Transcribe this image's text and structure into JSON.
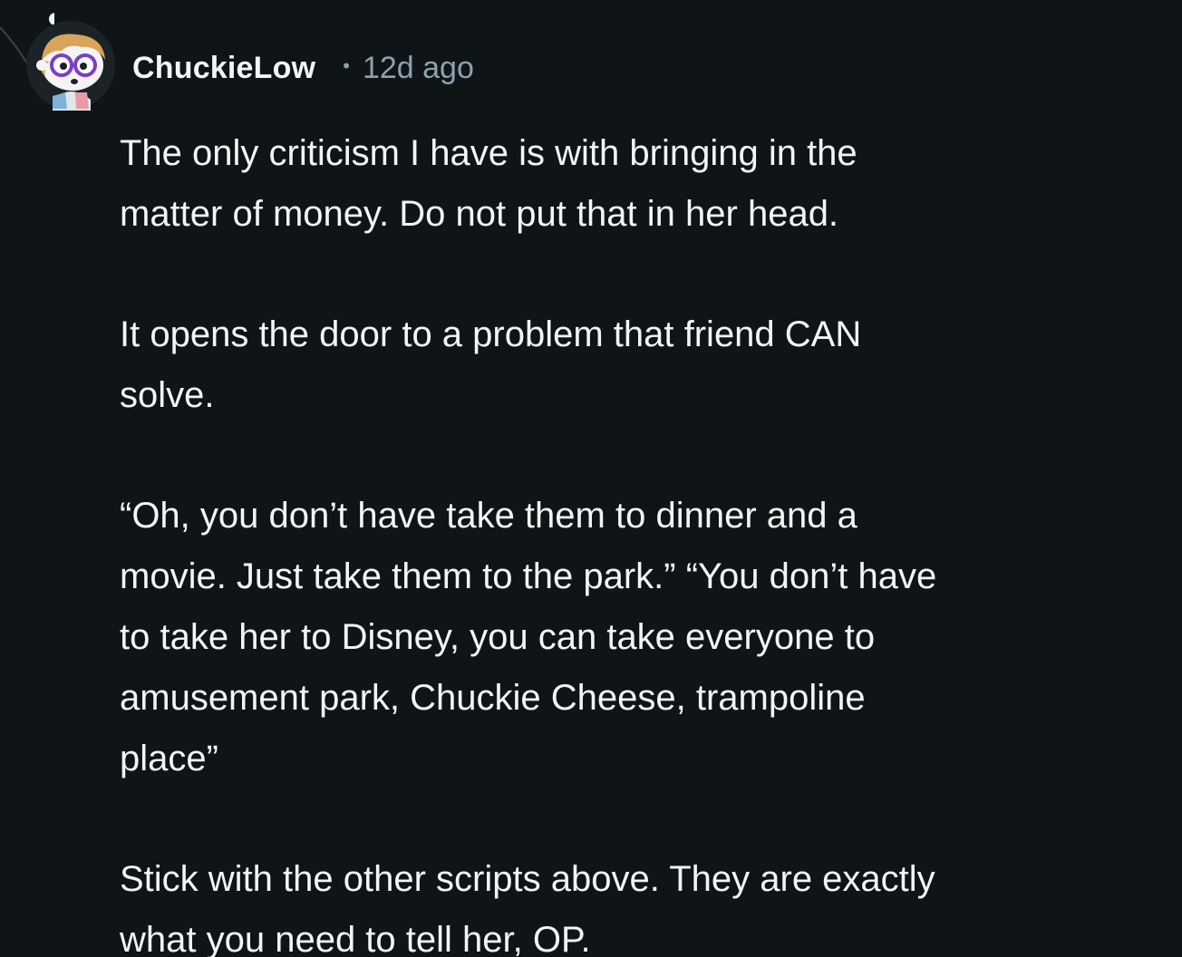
{
  "comment": {
    "author": "ChuckieLow",
    "separator": "•",
    "age": "12d ago",
    "avatar_icon": "snoo-avatar-icon",
    "paragraphs": [
      "The only criticism I have is with bringing in the\nmatter of money. Do not put that in her head.",
      "It opens the door to a problem that friend CAN\nsolve.",
      "“Oh, you don’t have take them to dinner and a\nmovie. Just take them to the park.” “You don’t have\nto take her to Disney, you can take everyone to\namusement park, Chuckie Cheese, trampoline\nplace”",
      "Stick with the other scripts above. They are exactly\nwhat you need to tell her, OP."
    ]
  },
  "colors": {
    "background": "#0f1416",
    "text": "#f2f4f5",
    "meta": "#8ba2ad"
  }
}
